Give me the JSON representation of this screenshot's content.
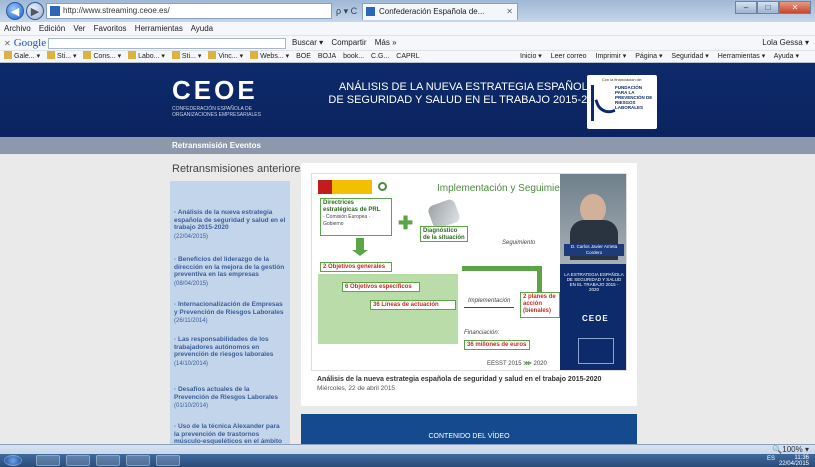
{
  "browser": {
    "address": "http://www.streaming.ceoe.es/",
    "address_ctrl": "ρ ▾ C",
    "tab_title": "Confederación Española de...",
    "tab_close": "✕",
    "window_buttons": [
      "–",
      "□",
      "✕"
    ]
  },
  "menu": [
    "Archivo",
    "Edición",
    "Ver",
    "Favoritos",
    "Herramientas",
    "Ayuda"
  ],
  "google_bar": {
    "logo": "Google",
    "close": "✕",
    "items": [
      "Buscar ▾",
      "Compartir",
      "Más »"
    ],
    "user": "Lola Gessa ▾"
  },
  "bookmarks": [
    "Gale... ▾",
    "Sti... ▾",
    "Cons... ▾",
    "Labo... ▾",
    "Sti... ▾",
    "Vinc... ▾",
    "Webs... ▾",
    "BOE",
    "BOJA",
    "book...",
    "C.G...",
    "CAPRL"
  ],
  "commands": [
    "Inicio ▾",
    "Leer correo",
    "Imprimir ▾",
    "Página ▾",
    "Seguridad ▾",
    "Herramientas ▾",
    "Ayuda ▾"
  ],
  "banner": {
    "logo": "CEOE",
    "logo_sub": "CONFEDERACIÓN ESPAÑOLA DE ORGANIZACIONES EMPRESARIALES",
    "title_line1": "ANÁLISIS DE LA NUEVA ESTRATEGIA ESPAÑOLA",
    "title_line2": "DE SEGURIDAD Y SALUD EN EL TRABAJO 2015-2020",
    "fund_top": "Con la financiación de:",
    "fund_text": "FUNDACIÓN PARA LA PREVENCIÓN DE RIESGOS LABORALES"
  },
  "subnav": {
    "label": "Retransmisión Eventos"
  },
  "section_title": "Retransmisiones anteriores",
  "sidebar_items": [
    {
      "title": "· Análisis de la nueva estrategia española de seguridad y salud en el trabajo 2015-2020",
      "date": "(22/04/2015)"
    },
    {
      "title": "· Beneficios del liderazgo de la dirección en la mejora de la gestión preventiva en las empresas",
      "date": "(08/04/2015)"
    },
    {
      "title": "· Internacionalización de Empresas y Prevención de Riesgos Laborales",
      "date": "(26/11/2014)"
    },
    {
      "title": "· Las responsabilidades de los trabajadores autónomos en prevención de riesgos laborales",
      "date": "(14/10/2014)"
    },
    {
      "title": "· Desafíos actuales de la Prevención de Riesgos Laborales",
      "date": "(01/10/2014)"
    },
    {
      "title": "· Uso de la técnica Alexander para la prevención de trastornos músculo-esqueléticos en el ámbito laboral",
      "date": ""
    }
  ],
  "slide": {
    "title": "Implementación y Seguimiento",
    "directrices": "Directrices estratégicas de PRL",
    "directrices_sub": "· Comisión Europea · Gobierno",
    "diagnostico": "Diagnóstico de la situación",
    "seguimiento": "Seguimiento",
    "objetivos_generales": "2 Objetivos generales",
    "objetivos_especificos": "6 Objetivos específicos",
    "lineas": "36 Líneas de actuación",
    "implementacion": "Implementación",
    "planes": "2 planes de acción (bienales)",
    "financiacion": "Financiación:",
    "millones": "36 millones de euros",
    "eesst_text": "EESST 2015",
    "eesst_year": "2020",
    "photo_caption": "D. Carlos Javier Arrieta Cordero",
    "panel_text": "LA ESTRATEGIA ESPAÑOLA DE SEGURIDAD Y SALUD EN EL TRABAJO 2015 - 2020",
    "panel_logo": "CEOE"
  },
  "content": {
    "caption": "Análisis de la nueva estrategia española de seguridad y salud en el trabajo 2015-2020",
    "date": "Miércoles, 22 de abril 2015",
    "block_label": "CONTENIDO DEL VÍDEO"
  },
  "status": {
    "zoom": "100%"
  },
  "taskbar": {
    "tray": "ES",
    "time": "11:36",
    "date": "22/04/2015"
  }
}
